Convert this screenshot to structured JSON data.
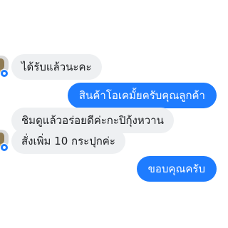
{
  "conversation": {
    "messages": [
      {
        "sender": "other",
        "text": "ได้รับแล้วนะคะ"
      },
      {
        "sender": "me",
        "text": "สินค้าโอเคมั้ยครับคุณลูกค้า"
      },
      {
        "sender": "other",
        "text": "ชิมดูแล้วอร่อยดีค่ะกะปิกุ้งหวาน"
      },
      {
        "sender": "other",
        "text": "สั่งเพิ่ม 10 กระปุกค่ะ"
      },
      {
        "sender": "me",
        "text": "ขอบคุณครับ"
      }
    ]
  },
  "colors": {
    "incoming_bubble": "#eef0f2",
    "outgoing_bubble": "#1e7cff",
    "messenger_badge": "#1e7cff"
  },
  "icons": {
    "avatar": "contact-avatar",
    "badge": "messenger-icon"
  }
}
